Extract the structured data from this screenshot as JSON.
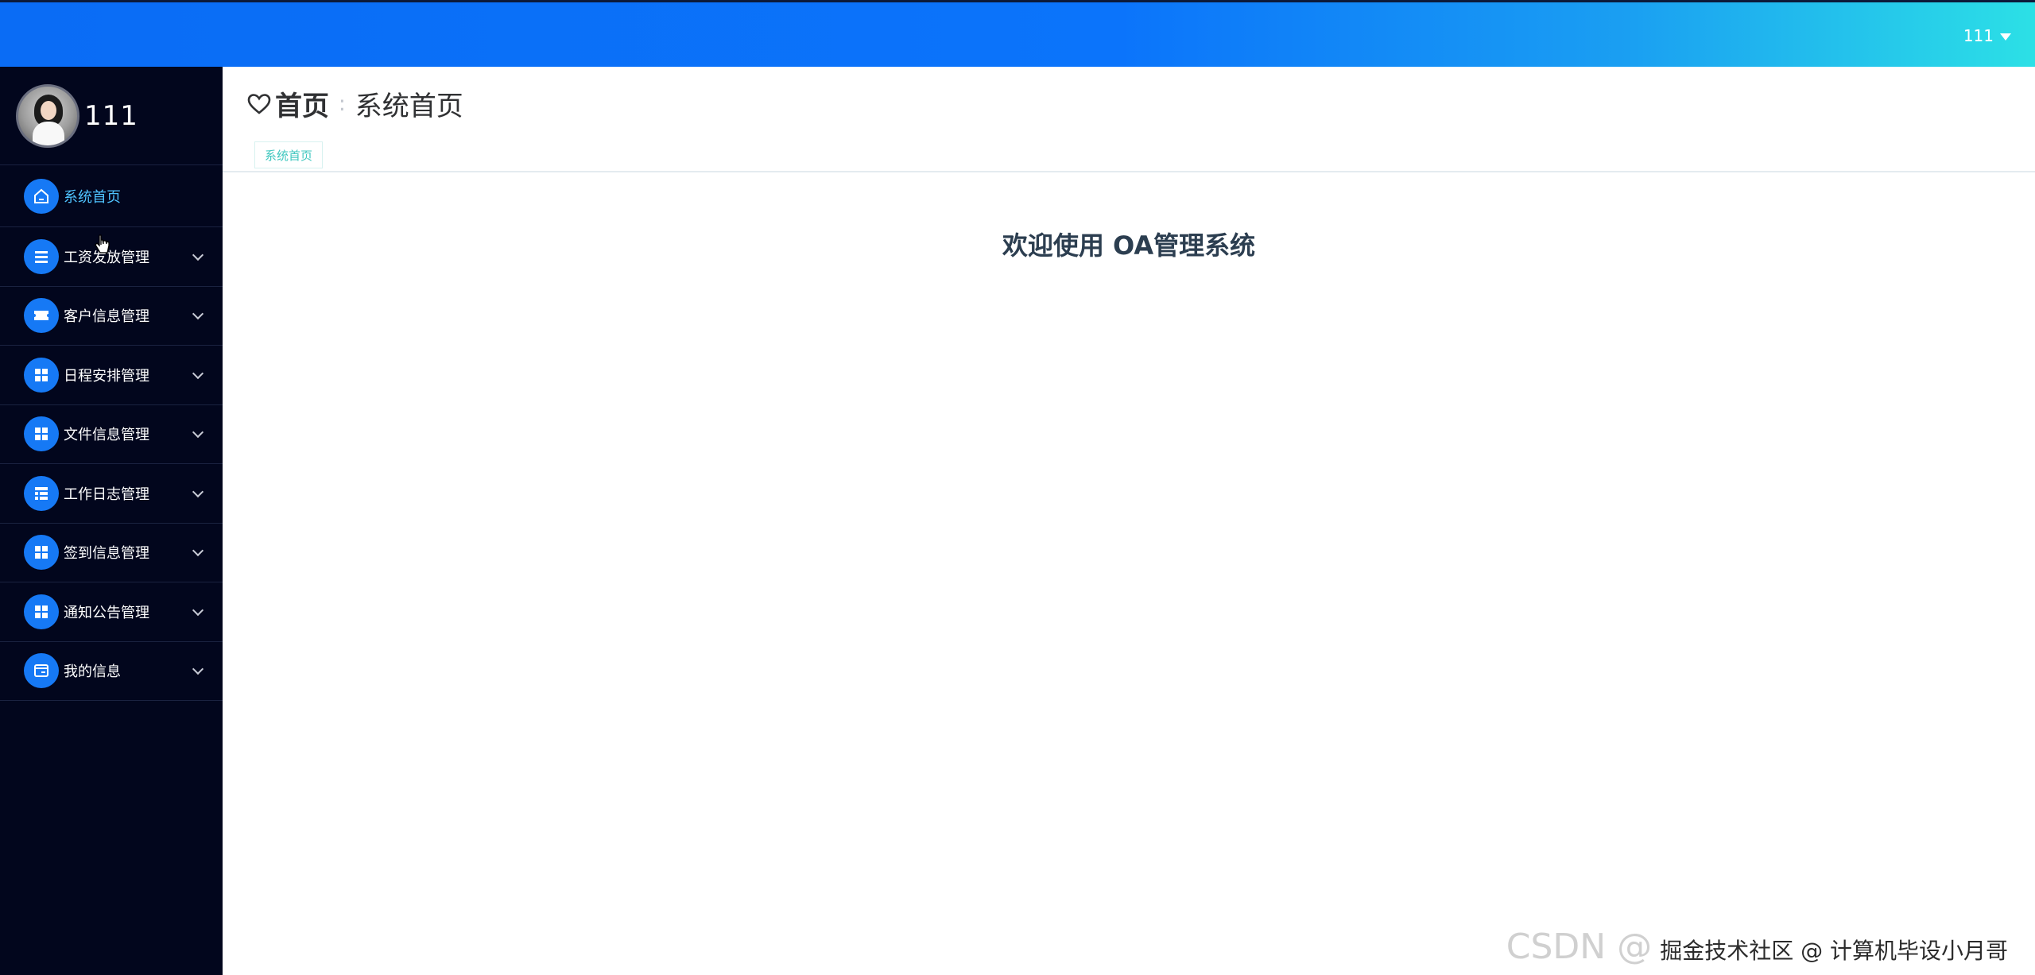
{
  "topbar": {
    "user": "111"
  },
  "sidebar": {
    "profile_name": "111",
    "items": [
      {
        "label": "系统首页",
        "icon": "home-icon",
        "active": true
      },
      {
        "label": "工资发放管理",
        "icon": "list-icon"
      },
      {
        "label": "客户信息管理",
        "icon": "ticket-icon"
      },
      {
        "label": "日程安排管理",
        "icon": "grid-icon"
      },
      {
        "label": "文件信息管理",
        "icon": "grid-icon"
      },
      {
        "label": "工作日志管理",
        "icon": "table-icon"
      },
      {
        "label": "签到信息管理",
        "icon": "grid-icon"
      },
      {
        "label": "通知公告管理",
        "icon": "grid-icon"
      },
      {
        "label": "我的信息",
        "icon": "card-icon"
      }
    ]
  },
  "breadcrumb": {
    "home": "首页",
    "separator": ":",
    "current": "系统首页"
  },
  "tags": [
    {
      "label": "系统首页"
    }
  ],
  "main": {
    "welcome": "欢迎使用 OA管理系统"
  },
  "watermark": {
    "outer": "CSDN @",
    "inner": "掘金技术社区 @ 计算机毕设小月哥"
  },
  "colors": {
    "topbar_start": "#0a6cf5",
    "topbar_end": "#2ce0e6",
    "sidebar_bg": "#02061d",
    "icon_bg": "#1679f5",
    "active_text": "#4fc3ff",
    "tag_text": "#3fc7bf"
  }
}
